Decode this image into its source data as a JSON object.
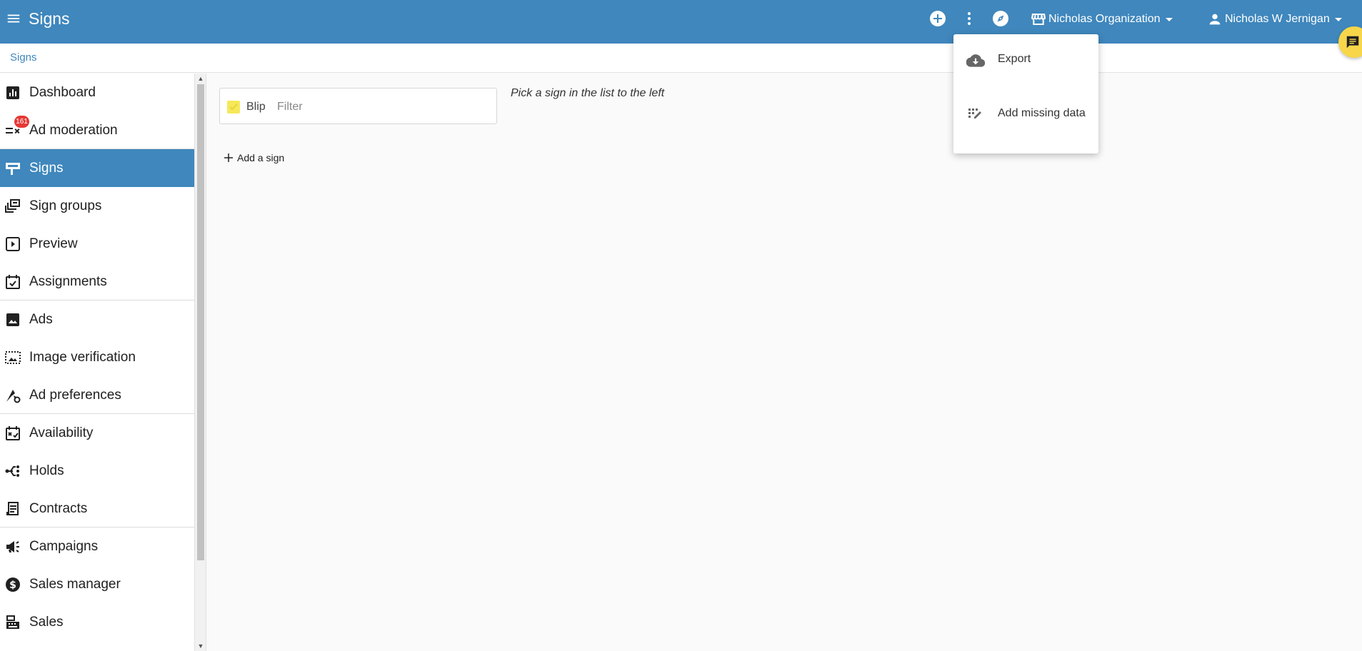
{
  "header": {
    "app_title": "Signs",
    "organization": "Nicholas Organization",
    "user": "Nicholas W Jernigan"
  },
  "breadcrumb": {
    "label": "Signs"
  },
  "sidebar": {
    "items": [
      {
        "label": "Dashboard",
        "icon": "dashboard-icon"
      },
      {
        "label": "Ad moderation",
        "icon": "moderation-icon",
        "badge": "161"
      },
      {
        "label": "Signs",
        "icon": "sign-icon",
        "active": true
      },
      {
        "label": "Sign groups",
        "icon": "sign-groups-icon"
      },
      {
        "label": "Preview",
        "icon": "preview-icon"
      },
      {
        "label": "Assignments",
        "icon": "assignments-icon"
      },
      {
        "label": "Ads",
        "icon": "image-icon"
      },
      {
        "label": "Image verification",
        "icon": "image-verification-icon"
      },
      {
        "label": "Ad preferences",
        "icon": "ad-preferences-icon"
      },
      {
        "label": "Availability",
        "icon": "availability-icon"
      },
      {
        "label": "Holds",
        "icon": "holds-icon"
      },
      {
        "label": "Contracts",
        "icon": "contracts-icon"
      },
      {
        "label": "Campaigns",
        "icon": "megaphone-icon"
      },
      {
        "label": "Sales manager",
        "icon": "dollar-icon"
      },
      {
        "label": "Sales",
        "icon": "register-icon"
      }
    ]
  },
  "filter": {
    "checkbox_label": "Blip",
    "placeholder": "Filter",
    "value": ""
  },
  "hint": "Pick a sign in the list to the left",
  "add_sign_label": "Add a sign",
  "menu": {
    "items": [
      {
        "label": "Export",
        "icon": "cloud-download-icon"
      },
      {
        "label": "Add missing data",
        "icon": "add-missing-data-icon"
      }
    ]
  },
  "colors": {
    "primary": "#3f87bd",
    "badge": "#e53935",
    "chat_fab": "#f7d64a",
    "checkbox": "#f5e85a"
  }
}
